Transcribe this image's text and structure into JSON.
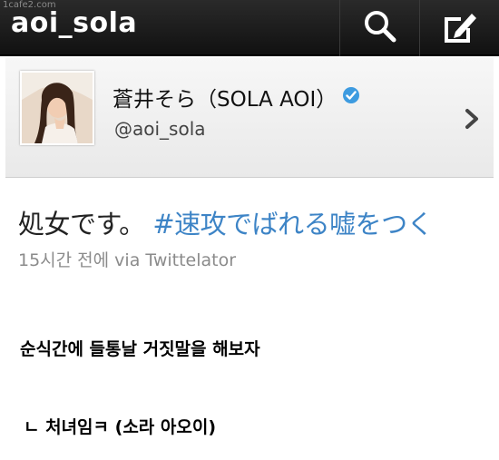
{
  "watermark": "1cafe2.com",
  "header": {
    "title": "aoi_sola",
    "search_icon": "search-icon",
    "compose_icon": "compose-icon"
  },
  "profile": {
    "display_name": "蒼井そら（SOLA AOI）",
    "handle": "@aoi_sola",
    "verified_color": "#3d9be0",
    "chevron_icon": "chevron-right-icon"
  },
  "tweet": {
    "text": "処女です。",
    "hashtag": "#速攻でばれる嘘をつく",
    "meta": "15시간 전에 via Twittelator",
    "hashtag_color": "#3d84c6"
  },
  "captions": {
    "line1": "순식간에 들통날 거짓말을 해보자",
    "line2": "ㄴ 처녀임ㅋ (소라 아오이)"
  }
}
